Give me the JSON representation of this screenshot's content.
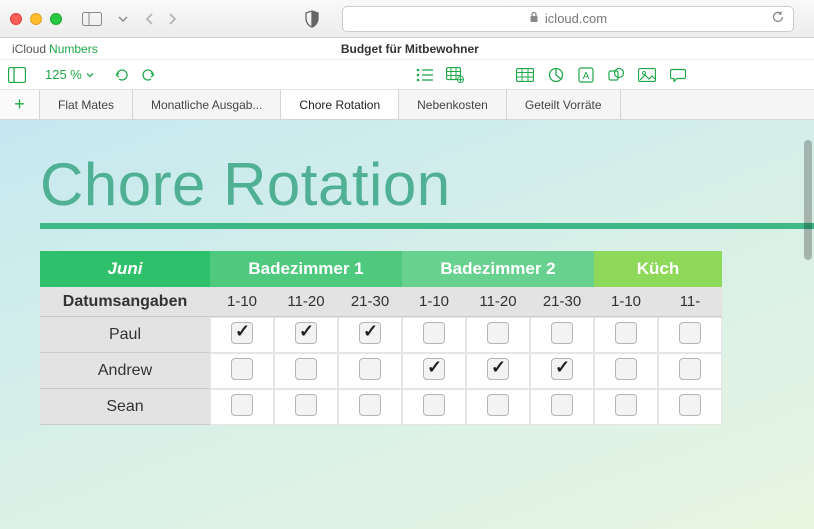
{
  "browser": {
    "url_host": "icloud.com"
  },
  "header": {
    "brand": "iCloud",
    "app": "Numbers",
    "doc_title": "Budget für Mitbewohner"
  },
  "toolbar": {
    "zoom": "125 %"
  },
  "tabs": [
    {
      "label": "Flat Mates",
      "active": false
    },
    {
      "label": "Monatliche Ausgab...",
      "active": false
    },
    {
      "label": "Chore Rotation",
      "active": true
    },
    {
      "label": "Nebenkosten",
      "active": false
    },
    {
      "label": "Geteilt Vorräte",
      "active": false
    }
  ],
  "sheet": {
    "title": "Chore Rotation",
    "table": {
      "month": "Juni",
      "groups": [
        "Badezimmer 1",
        "Badezimmer 2",
        "Küch"
      ],
      "dates_label": "Datumsangaben",
      "subheaders": [
        "1-10",
        "11-20",
        "21-30",
        "1-10",
        "11-20",
        "21-30",
        "1-10",
        "11-"
      ],
      "rows": [
        {
          "name": "Paul",
          "checks": [
            true,
            true,
            true,
            false,
            false,
            false,
            false,
            false
          ]
        },
        {
          "name": "Andrew",
          "checks": [
            false,
            false,
            false,
            true,
            true,
            true,
            false,
            false
          ]
        },
        {
          "name": "Sean",
          "checks": [
            false,
            false,
            false,
            false,
            false,
            false,
            false,
            false
          ]
        }
      ]
    }
  }
}
